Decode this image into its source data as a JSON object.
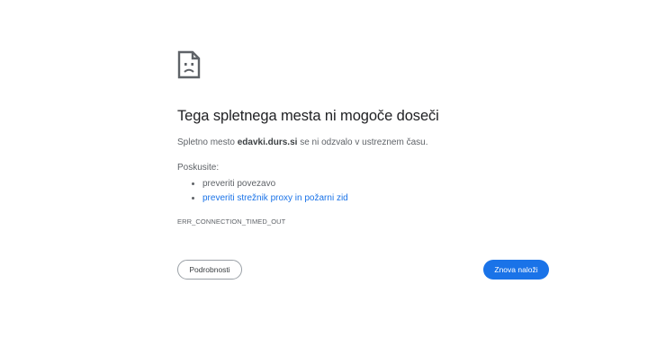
{
  "error": {
    "icon": "sad-document-icon",
    "title": "Tega spletnega mesta ni mogoče doseči",
    "summary_prefix": "Spletno mesto ",
    "host": "edavki.durs.si",
    "summary_suffix": " se ni odzvalo v ustreznem času.",
    "suggestions_heading": "Poskusite:",
    "suggestions": [
      {
        "label": "preveriti povezavo",
        "is_link": false
      },
      {
        "label": "preveriti strežnik proxy in požarni zid",
        "is_link": true
      }
    ],
    "code": "ERR_CONNECTION_TIMED_OUT"
  },
  "buttons": {
    "details_label": "Podrobnosti",
    "reload_label": "Znova naloži"
  },
  "colors": {
    "accent": "#1a73e8",
    "text": "#202124",
    "secondary_text": "#5f6368"
  }
}
